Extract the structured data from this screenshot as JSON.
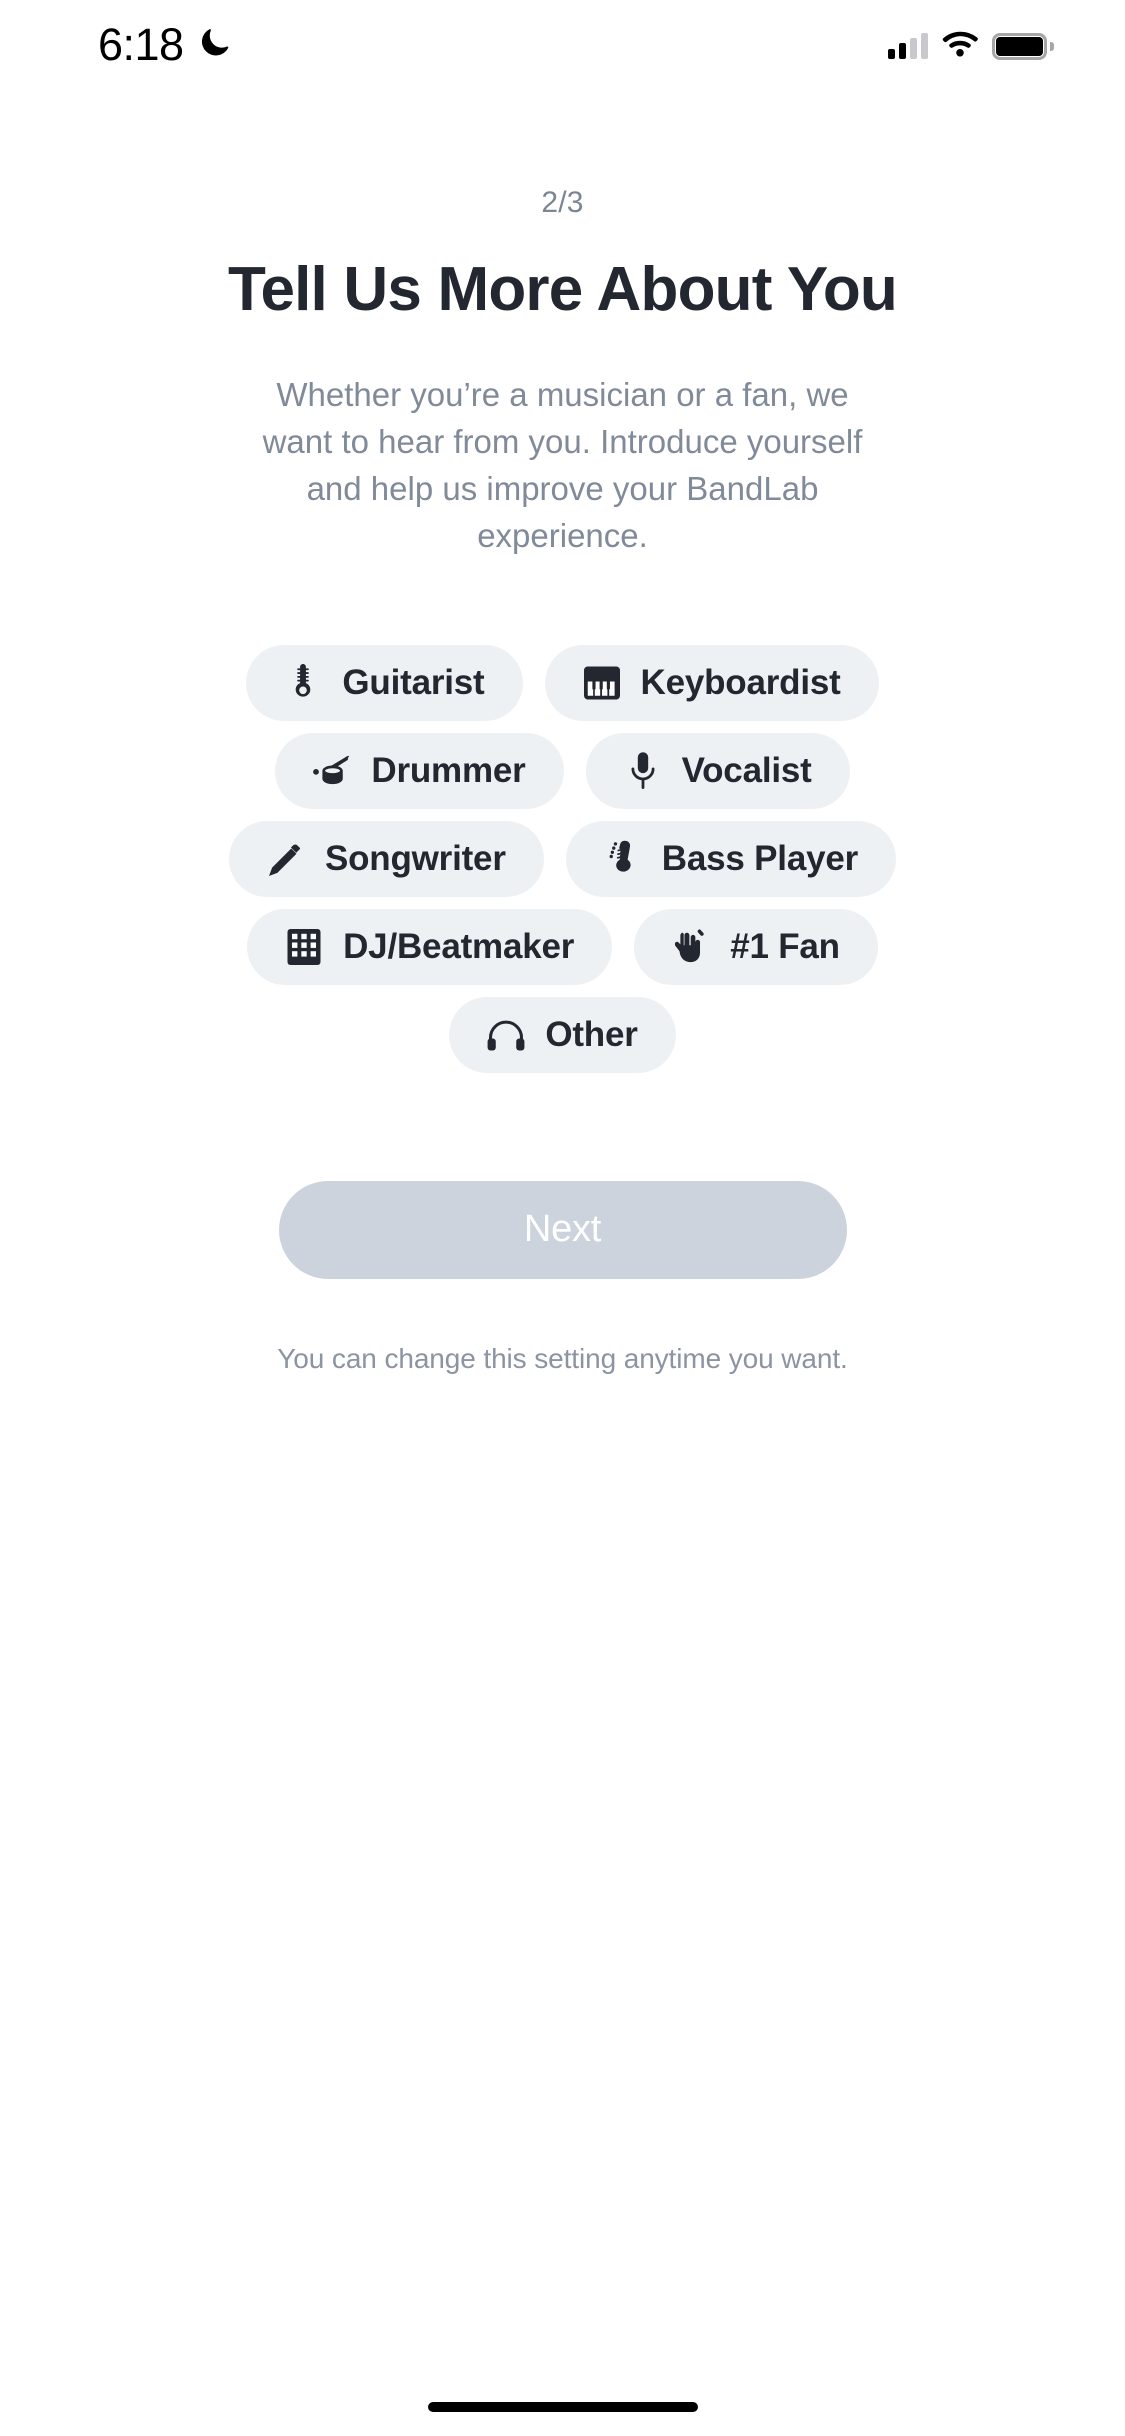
{
  "status_bar": {
    "time": "6:18",
    "dnd_icon": "moon-icon",
    "signal_icon": "cellular-signal-icon",
    "wifi_icon": "wifi-icon",
    "battery_icon": "battery-icon"
  },
  "onboarding": {
    "step_indicator": "2/3",
    "title": "Tell Us More About You",
    "subtitle": "Whether you’re a musician or a fan, we want to hear from you. Introduce yourself and help us improve your BandLab experience.",
    "footnote": "You can change this setting anytime you want.",
    "next_label": "Next",
    "next_enabled": false,
    "chip_background": "#eef1f4",
    "chip_text_color": "#232730",
    "next_button_color": "#ccd3dc",
    "rows": [
      {
        "chips": [
          {
            "label": "Guitarist",
            "icon": "guitar-headstock-icon",
            "selected": false
          },
          {
            "label": "Keyboardist",
            "icon": "piano-keys-icon",
            "selected": false
          }
        ]
      },
      {
        "chips": [
          {
            "label": "Drummer",
            "icon": "snare-drum-icon",
            "selected": false
          },
          {
            "label": "Vocalist",
            "icon": "microphone-icon",
            "selected": false
          }
        ]
      },
      {
        "chips": [
          {
            "label": "Songwriter",
            "icon": "pencil-icon",
            "selected": false
          },
          {
            "label": "Bass Player",
            "icon": "bass-headstock-icon",
            "selected": false
          }
        ]
      },
      {
        "chips": [
          {
            "label": "DJ/Beatmaker",
            "icon": "drum-pad-grid-icon",
            "selected": false
          },
          {
            "label": "#1 Fan",
            "icon": "rock-hand-icon",
            "selected": false
          }
        ]
      },
      {
        "chips": [
          {
            "label": "Other",
            "icon": "headphones-icon",
            "selected": false
          }
        ]
      }
    ]
  }
}
